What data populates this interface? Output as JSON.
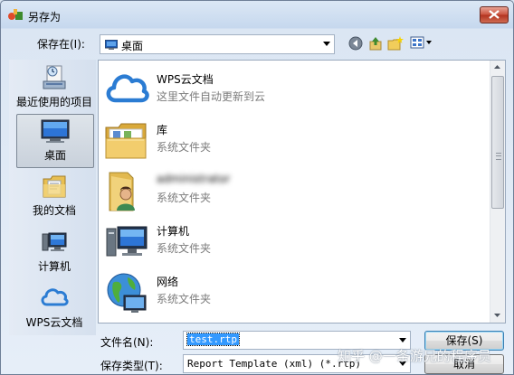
{
  "window": {
    "title": "另存为",
    "close_icon": "close-icon"
  },
  "toolbar": {
    "look_in_label": "保存在(I):",
    "look_in_value": "桌面",
    "icons": [
      "back-icon",
      "up-folder-icon",
      "new-folder-icon",
      "view-menu-icon"
    ]
  },
  "places": [
    {
      "label": "最近使用的项目",
      "icon": "recent-items-icon",
      "active": false
    },
    {
      "label": "桌面",
      "icon": "desktop-icon",
      "active": true
    },
    {
      "label": "我的文档",
      "icon": "my-documents-icon",
      "active": false
    },
    {
      "label": "计算机",
      "icon": "computer-icon",
      "active": false
    },
    {
      "label": "WPS云文档",
      "icon": "cloud-icon",
      "active": false
    }
  ],
  "files": [
    {
      "name": "WPS云文档",
      "sub": "这里文件自动更新到云",
      "icon": "cloud-icon"
    },
    {
      "name": "库",
      "sub": "系统文件夹",
      "icon": "library-icon"
    },
    {
      "name": "administrator",
      "sub": "系统文件夹",
      "icon": "user-folder-icon",
      "obscured": true
    },
    {
      "name": "计算机",
      "sub": "系统文件夹",
      "icon": "computer-icon"
    },
    {
      "name": "网络",
      "sub": "系统文件夹",
      "icon": "network-icon"
    }
  ],
  "form": {
    "filename_label": "文件名(N):",
    "filename_value": "test.rtp",
    "filetype_label": "保存类型(T):",
    "filetype_value": "Report Template (xml) (*.rtp)",
    "save_button": "保存(S)",
    "cancel_button": "取消"
  },
  "watermark": "知乎 @一条游兄的程序员",
  "colors": {
    "accent": "#3399ff",
    "close_red": "#c9503b",
    "cloud_blue": "#2b7cd3"
  }
}
